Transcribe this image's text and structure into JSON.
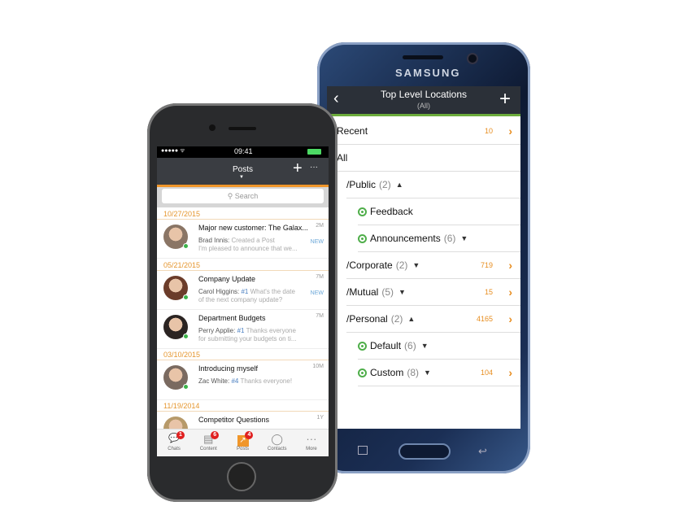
{
  "samsung": {
    "brand": "SAMSUNG",
    "title": "Top Level Locations",
    "subtitle": "(All)",
    "rows": [
      {
        "label": "Recent",
        "count": "",
        "toggle": "",
        "number": "10",
        "chevron": true,
        "ring": false,
        "indent": 0,
        "bold": true
      },
      {
        "label": "All",
        "count": "",
        "toggle": "",
        "number": "",
        "chevron": false,
        "ring": false,
        "indent": 0,
        "bold": false
      },
      {
        "label": "/Public",
        "count": "(2)",
        "toggle": "▲",
        "number": "",
        "chevron": false,
        "ring": false,
        "indent": 1,
        "bold": false
      },
      {
        "label": "Feedback",
        "count": "",
        "toggle": "",
        "number": "",
        "chevron": false,
        "ring": true,
        "indent": 2,
        "bold": false
      },
      {
        "label": "Announcements",
        "count": "(6)",
        "toggle": "▼",
        "number": "",
        "chevron": false,
        "ring": true,
        "indent": 2,
        "bold": false
      },
      {
        "label": "/Corporate",
        "count": "(2)",
        "toggle": "▼",
        "number": "719",
        "chevron": true,
        "ring": false,
        "indent": 1,
        "bold": true
      },
      {
        "label": "/Mutual",
        "count": "(5)",
        "toggle": "▼",
        "number": "15",
        "chevron": true,
        "ring": false,
        "indent": 1,
        "bold": true
      },
      {
        "label": "/Personal",
        "count": "(2)",
        "toggle": "▲",
        "number": "4165",
        "chevron": true,
        "ring": false,
        "indent": 1,
        "bold": true
      },
      {
        "label": "Default",
        "count": "(6)",
        "toggle": "▼",
        "number": "",
        "chevron": false,
        "ring": true,
        "indent": 2,
        "bold": true
      },
      {
        "label": "Custom",
        "count": "(8)",
        "toggle": "▼",
        "number": "104",
        "chevron": true,
        "ring": true,
        "indent": 2,
        "bold": true
      }
    ]
  },
  "iphone": {
    "time": "09:41",
    "title": "Posts",
    "search_placeholder": "Search",
    "dates": [
      "10/27/2015",
      "05/21/2015",
      "03/10/2015",
      "11/19/2014"
    ],
    "posts": [
      {
        "title": "Major new customer: The Galax...",
        "time": "2M",
        "author": "Brad Innis:",
        "tag": "",
        "line1": "Created a Post",
        "line2": "I'm pleased to announce that we...",
        "new": "NEW",
        "avatar": "#8a7565"
      },
      {
        "title": "Company Update",
        "time": "7M",
        "author": "Carol Higgins:",
        "tag": "#1",
        "line1": "What's the date",
        "line2": "of the next company update?",
        "new": "NEW",
        "avatar": "#6b3c2a"
      },
      {
        "title": "Department Budgets",
        "time": "7M",
        "author": "Perry Applie:",
        "tag": "#1",
        "line1": "Thanks everyone",
        "line2": "for submitting your budgets on ti...",
        "new": "",
        "avatar": "#2b2422"
      },
      {
        "title": "Introducing myself",
        "time": "10M",
        "author": "Zac White:",
        "tag": "#4",
        "line1": "Thanks everyone!",
        "line2": "",
        "new": "",
        "avatar": "#7a6a60"
      },
      {
        "title": "Competitor Questions",
        "time": "1Y",
        "author": "",
        "tag": "",
        "line1": "",
        "line2": "",
        "new": "",
        "avatar": "#b79a6a"
      }
    ],
    "tabs": [
      {
        "label": "Chats",
        "icon": "chat-icon",
        "badge": "1"
      },
      {
        "label": "Content",
        "icon": "document-icon",
        "badge": "6"
      },
      {
        "label": "Posts",
        "icon": "posts-icon",
        "badge": "4"
      },
      {
        "label": "Contacts",
        "icon": "contact-icon",
        "badge": ""
      },
      {
        "label": "More",
        "icon": "more-icon",
        "badge": ""
      }
    ]
  },
  "colors": {
    "accent_orange": "#f0962a",
    "accent_green": "#6cac3c",
    "badge_red": "#e02020"
  }
}
